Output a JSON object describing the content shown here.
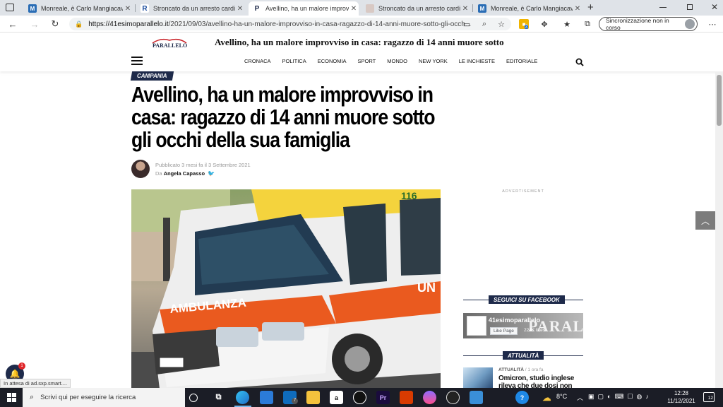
{
  "browser": {
    "tabs": [
      {
        "title": "Monreale, è Carlo Mangiacavallo",
        "favicon": "M"
      },
      {
        "title": "Stroncato da un arresto cardiaco",
        "favicon": "R"
      },
      {
        "title": "Avellino, ha un malore improvviso",
        "favicon": "P"
      },
      {
        "title": "Stroncato da un arresto cardiaco",
        "favicon": ""
      },
      {
        "title": "Monreale, è Carlo Mangiacavallo",
        "favicon": "M"
      }
    ],
    "active_tab_index": 2,
    "url_domain": "https://41esimoparallelo.it",
    "url_path": "/2021/09/03/avellino-ha-un-malore-improvviso-in-casa-ragazzo-di-14-anni-muore-sotto-gli-occh...",
    "extension_badge": "2",
    "sync_label": "Sincronizzazione non in corso"
  },
  "site": {
    "logo_text": "PARALLELO",
    "header_title": "Avellino, ha un malore improvviso in casa: ragazzo di 14 anni muore sotto",
    "nav": [
      "CRONACA",
      "POLITICA",
      "ECONOMIA",
      "SPORT",
      "MONDO",
      "NEW YORK",
      "LE INCHIESTE",
      "EDITORIALE"
    ]
  },
  "article": {
    "category": "CAMPANIA",
    "headline": "Avellino, ha un malore improvviso in casa: ragazzo di 14 anni muore sotto gli occhi della sua famiglia",
    "published": "Pubblicato 3 mesi fa il 3 Settembre 2021",
    "by_prefix": "Da",
    "author": "Angela Capasso",
    "ambulance_number": "116",
    "ambulance_text": "AMBULANZA",
    "ambulance_side": "UN"
  },
  "sidebar": {
    "ad_label": "ADVERTISEMENT",
    "facebook_heading": "SEGUICI SU FACEBOOK",
    "facebook_page": "41esimoparallelo",
    "facebook_like": "Like Page",
    "facebook_likes": "224K likes",
    "facebook_watermark": "PARALLELO",
    "news_heading": "ATTUALITÀ",
    "news_category": "ATTUALITÀ",
    "news_time": "1 ora fa",
    "news_title": "Omicron, studio inglese rileva che due dosi non difendono dalla"
  },
  "overlay": {
    "status_text": "In attesa di ad.sxp.smart....",
    "bell_badge": "1"
  },
  "taskbar": {
    "search_placeholder": "Scrivi qui per eseguire la ricerca",
    "weather": "8°C",
    "time": "12:28",
    "date": "11/12/2021",
    "notifications": "12",
    "mail_badge": "7"
  }
}
